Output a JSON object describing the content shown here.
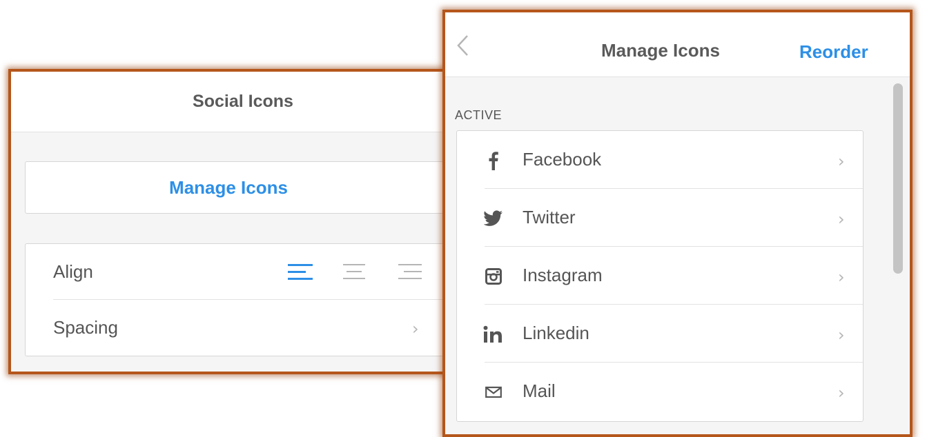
{
  "social_panel": {
    "title": "Social Icons",
    "manage_button_label": "Manage Icons",
    "settings": {
      "align_label": "Align",
      "align_options": [
        "align-left",
        "align-center",
        "align-right"
      ],
      "align_selected": "align-left",
      "spacing_label": "Spacing"
    }
  },
  "manage_panel": {
    "title": "Manage Icons",
    "reorder_label": "Reorder",
    "section_label": "ACTIVE",
    "items": [
      {
        "label": "Facebook",
        "icon": "facebook-icon"
      },
      {
        "label": "Twitter",
        "icon": "twitter-icon"
      },
      {
        "label": "Instagram",
        "icon": "instagram-icon"
      },
      {
        "label": "Linkedin",
        "icon": "linkedin-icon"
      },
      {
        "label": "Mail",
        "icon": "mail-icon"
      }
    ]
  },
  "colors": {
    "accent": "#2d8fe6",
    "panel_border": "#b5561b",
    "text": "#555555",
    "muted_icon": "#b5b5b5"
  }
}
